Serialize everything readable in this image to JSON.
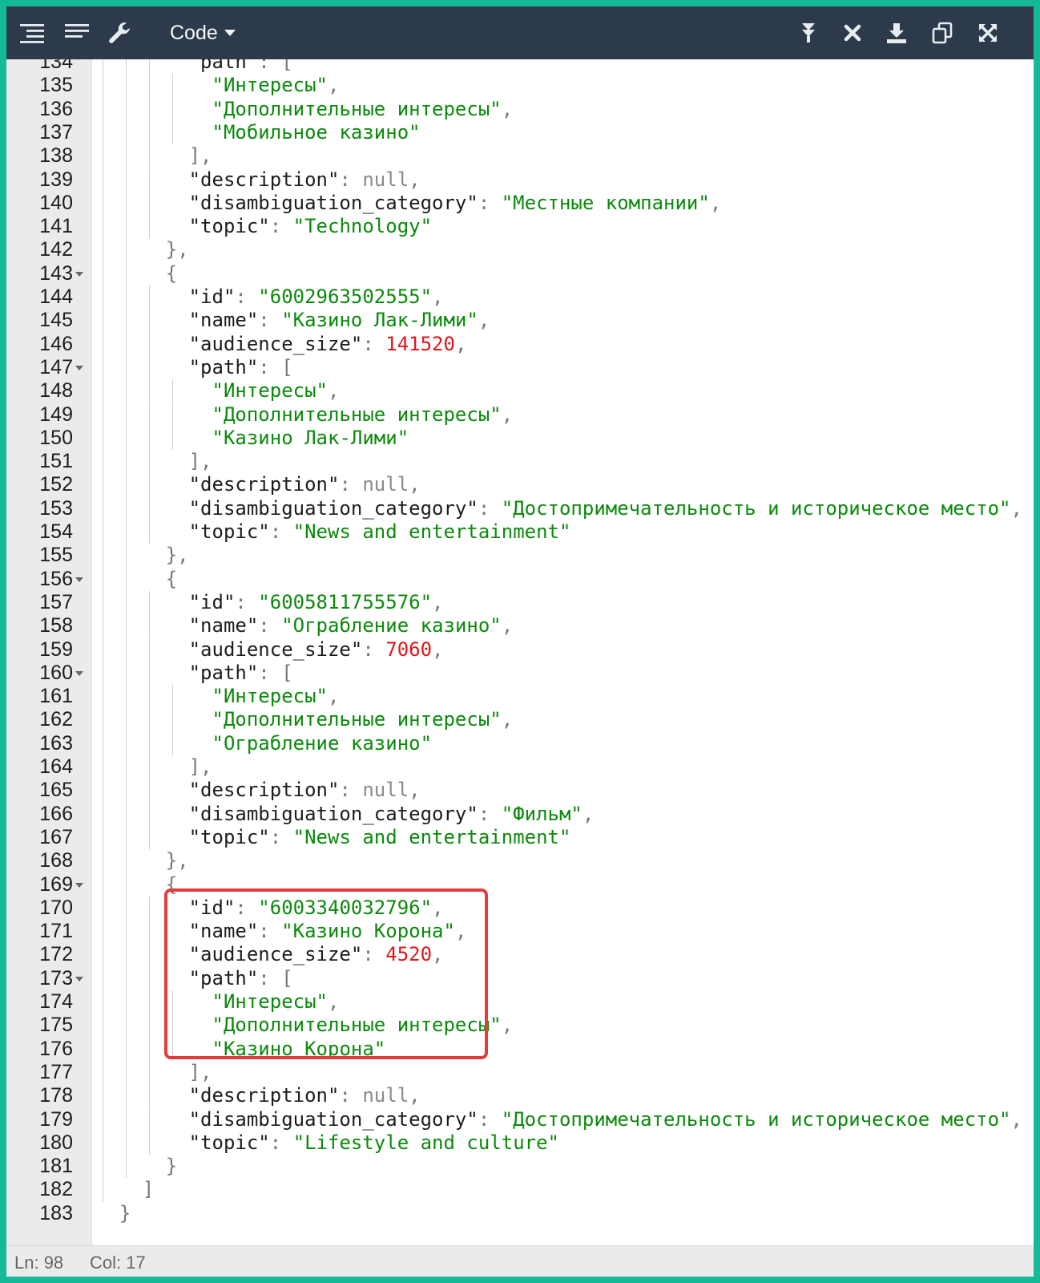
{
  "toolbar": {
    "mode_label": "Code",
    "buttons": [
      {
        "name": "format-icon"
      },
      {
        "name": "compact-icon"
      },
      {
        "name": "repair-icon"
      }
    ],
    "right_buttons": [
      {
        "name": "sort-icon"
      },
      {
        "name": "filter-icon"
      },
      {
        "name": "download-icon"
      },
      {
        "name": "copy-icon"
      },
      {
        "name": "fullscreen-icon"
      }
    ]
  },
  "editor": {
    "lines": [
      {
        "n": "134",
        "indent": 4,
        "parts": [
          [
            "k",
            "\"path\""
          ],
          [
            "p",
            ": ["
          ]
        ],
        "partial": true
      },
      {
        "n": "135",
        "indent": 5,
        "parts": [
          [
            "s",
            "\"Интересы\""
          ],
          [
            "p",
            ","
          ]
        ]
      },
      {
        "n": "136",
        "indent": 5,
        "parts": [
          [
            "s",
            "\"Дополнительные интересы\""
          ],
          [
            "p",
            ","
          ]
        ]
      },
      {
        "n": "137",
        "indent": 5,
        "parts": [
          [
            "s",
            "\"Мобильное казино\""
          ]
        ]
      },
      {
        "n": "138",
        "indent": 4,
        "parts": [
          [
            "p",
            "],"
          ]
        ]
      },
      {
        "n": "139",
        "indent": 4,
        "parts": [
          [
            "k",
            "\"description\""
          ],
          [
            "p",
            ": "
          ],
          [
            "nul",
            "null"
          ],
          [
            "p",
            ","
          ]
        ]
      },
      {
        "n": "140",
        "indent": 4,
        "parts": [
          [
            "k",
            "\"disambiguation_category\""
          ],
          [
            "p",
            ": "
          ],
          [
            "s",
            "\"Местные компании\""
          ],
          [
            "p",
            ","
          ]
        ]
      },
      {
        "n": "141",
        "indent": 4,
        "parts": [
          [
            "k",
            "\"topic\""
          ],
          [
            "p",
            ": "
          ],
          [
            "s",
            "\"Technology\""
          ]
        ]
      },
      {
        "n": "142",
        "indent": 3,
        "parts": [
          [
            "p",
            "},"
          ]
        ]
      },
      {
        "n": "143",
        "indent": 3,
        "fold": true,
        "parts": [
          [
            "p",
            "{"
          ]
        ]
      },
      {
        "n": "144",
        "indent": 4,
        "parts": [
          [
            "k",
            "\"id\""
          ],
          [
            "p",
            ": "
          ],
          [
            "s",
            "\"6002963502555\""
          ],
          [
            "p",
            ","
          ]
        ]
      },
      {
        "n": "145",
        "indent": 4,
        "parts": [
          [
            "k",
            "\"name\""
          ],
          [
            "p",
            ": "
          ],
          [
            "s",
            "\"Казино Лак-Лими\""
          ],
          [
            "p",
            ","
          ]
        ]
      },
      {
        "n": "146",
        "indent": 4,
        "parts": [
          [
            "k",
            "\"audience_size\""
          ],
          [
            "p",
            ": "
          ],
          [
            "n",
            "141520"
          ],
          [
            "p",
            ","
          ]
        ]
      },
      {
        "n": "147",
        "indent": 4,
        "fold": true,
        "parts": [
          [
            "k",
            "\"path\""
          ],
          [
            "p",
            ": ["
          ]
        ]
      },
      {
        "n": "148",
        "indent": 5,
        "parts": [
          [
            "s",
            "\"Интересы\""
          ],
          [
            "p",
            ","
          ]
        ]
      },
      {
        "n": "149",
        "indent": 5,
        "parts": [
          [
            "s",
            "\"Дополнительные интересы\""
          ],
          [
            "p",
            ","
          ]
        ]
      },
      {
        "n": "150",
        "indent": 5,
        "parts": [
          [
            "s",
            "\"Казино Лак-Лими\""
          ]
        ]
      },
      {
        "n": "151",
        "indent": 4,
        "parts": [
          [
            "p",
            "],"
          ]
        ]
      },
      {
        "n": "152",
        "indent": 4,
        "parts": [
          [
            "k",
            "\"description\""
          ],
          [
            "p",
            ": "
          ],
          [
            "nul",
            "null"
          ],
          [
            "p",
            ","
          ]
        ]
      },
      {
        "n": "153",
        "indent": 4,
        "parts": [
          [
            "k",
            "\"disambiguation_category\""
          ],
          [
            "p",
            ": "
          ],
          [
            "s",
            "\"Достопримечательность и историческое место\""
          ],
          [
            "p",
            ","
          ]
        ]
      },
      {
        "n": "154",
        "indent": 4,
        "parts": [
          [
            "k",
            "\"topic\""
          ],
          [
            "p",
            ": "
          ],
          [
            "s",
            "\"News and entertainment\""
          ]
        ]
      },
      {
        "n": "155",
        "indent": 3,
        "parts": [
          [
            "p",
            "},"
          ]
        ]
      },
      {
        "n": "156",
        "indent": 3,
        "fold": true,
        "parts": [
          [
            "p",
            "{"
          ]
        ]
      },
      {
        "n": "157",
        "indent": 4,
        "parts": [
          [
            "k",
            "\"id\""
          ],
          [
            "p",
            ": "
          ],
          [
            "s",
            "\"6005811755576\""
          ],
          [
            "p",
            ","
          ]
        ]
      },
      {
        "n": "158",
        "indent": 4,
        "parts": [
          [
            "k",
            "\"name\""
          ],
          [
            "p",
            ": "
          ],
          [
            "s",
            "\"Ограбление казино\""
          ],
          [
            "p",
            ","
          ]
        ]
      },
      {
        "n": "159",
        "indent": 4,
        "parts": [
          [
            "k",
            "\"audience_size\""
          ],
          [
            "p",
            ": "
          ],
          [
            "n",
            "7060"
          ],
          [
            "p",
            ","
          ]
        ]
      },
      {
        "n": "160",
        "indent": 4,
        "fold": true,
        "parts": [
          [
            "k",
            "\"path\""
          ],
          [
            "p",
            ": ["
          ]
        ]
      },
      {
        "n": "161",
        "indent": 5,
        "parts": [
          [
            "s",
            "\"Интересы\""
          ],
          [
            "p",
            ","
          ]
        ]
      },
      {
        "n": "162",
        "indent": 5,
        "parts": [
          [
            "s",
            "\"Дополнительные интересы\""
          ],
          [
            "p",
            ","
          ]
        ]
      },
      {
        "n": "163",
        "indent": 5,
        "parts": [
          [
            "s",
            "\"Ограбление казино\""
          ]
        ]
      },
      {
        "n": "164",
        "indent": 4,
        "parts": [
          [
            "p",
            "],"
          ]
        ]
      },
      {
        "n": "165",
        "indent": 4,
        "parts": [
          [
            "k",
            "\"description\""
          ],
          [
            "p",
            ": "
          ],
          [
            "nul",
            "null"
          ],
          [
            "p",
            ","
          ]
        ]
      },
      {
        "n": "166",
        "indent": 4,
        "parts": [
          [
            "k",
            "\"disambiguation_category\""
          ],
          [
            "p",
            ": "
          ],
          [
            "s",
            "\"Фильм\""
          ],
          [
            "p",
            ","
          ]
        ]
      },
      {
        "n": "167",
        "indent": 4,
        "parts": [
          [
            "k",
            "\"topic\""
          ],
          [
            "p",
            ": "
          ],
          [
            "s",
            "\"News and entertainment\""
          ]
        ]
      },
      {
        "n": "168",
        "indent": 3,
        "parts": [
          [
            "p",
            "},"
          ]
        ]
      },
      {
        "n": "169",
        "indent": 3,
        "fold": true,
        "parts": [
          [
            "p",
            "{"
          ]
        ]
      },
      {
        "n": "170",
        "indent": 4,
        "parts": [
          [
            "k",
            "\"id\""
          ],
          [
            "p",
            ": "
          ],
          [
            "s",
            "\"6003340032796\""
          ],
          [
            "p",
            ","
          ]
        ]
      },
      {
        "n": "171",
        "indent": 4,
        "parts": [
          [
            "k",
            "\"name\""
          ],
          [
            "p",
            ": "
          ],
          [
            "s",
            "\"Казино Корона\""
          ],
          [
            "p",
            ","
          ]
        ]
      },
      {
        "n": "172",
        "indent": 4,
        "parts": [
          [
            "k",
            "\"audience_size\""
          ],
          [
            "p",
            ": "
          ],
          [
            "n",
            "4520"
          ],
          [
            "p",
            ","
          ]
        ]
      },
      {
        "n": "173",
        "indent": 4,
        "fold": true,
        "parts": [
          [
            "k",
            "\"path\""
          ],
          [
            "p",
            ": ["
          ]
        ]
      },
      {
        "n": "174",
        "indent": 5,
        "parts": [
          [
            "s",
            "\"Интересы\""
          ],
          [
            "p",
            ","
          ]
        ]
      },
      {
        "n": "175",
        "indent": 5,
        "parts": [
          [
            "s",
            "\"Дополнительные интересы\""
          ],
          [
            "p",
            ","
          ]
        ]
      },
      {
        "n": "176",
        "indent": 5,
        "parts": [
          [
            "s",
            "\"Казино Корона\""
          ]
        ]
      },
      {
        "n": "177",
        "indent": 4,
        "parts": [
          [
            "p",
            "],"
          ]
        ]
      },
      {
        "n": "178",
        "indent": 4,
        "parts": [
          [
            "k",
            "\"description\""
          ],
          [
            "p",
            ": "
          ],
          [
            "nul",
            "null"
          ],
          [
            "p",
            ","
          ]
        ]
      },
      {
        "n": "179",
        "indent": 4,
        "parts": [
          [
            "k",
            "\"disambiguation_category\""
          ],
          [
            "p",
            ": "
          ],
          [
            "s",
            "\"Достопримечательность и историческое место\""
          ],
          [
            "p",
            ","
          ]
        ]
      },
      {
        "n": "180",
        "indent": 4,
        "parts": [
          [
            "k",
            "\"topic\""
          ],
          [
            "p",
            ": "
          ],
          [
            "s",
            "\"Lifestyle and culture\""
          ]
        ]
      },
      {
        "n": "181",
        "indent": 3,
        "parts": [
          [
            "p",
            "}"
          ]
        ]
      },
      {
        "n": "182",
        "indent": 2,
        "parts": [
          [
            "p",
            "]"
          ]
        ]
      },
      {
        "n": "183",
        "indent": 1,
        "parts": [
          [
            "p",
            "}"
          ]
        ]
      }
    ]
  },
  "status": {
    "ln_label": "Ln: 98",
    "col_label": "Col: 17"
  },
  "colors": {
    "toolbar_bg": "#2d3a4b",
    "frame_border": "#16b89a",
    "string": "#0b8a0b",
    "number": "#e0161b",
    "highlight_box": "#e23c3c"
  }
}
